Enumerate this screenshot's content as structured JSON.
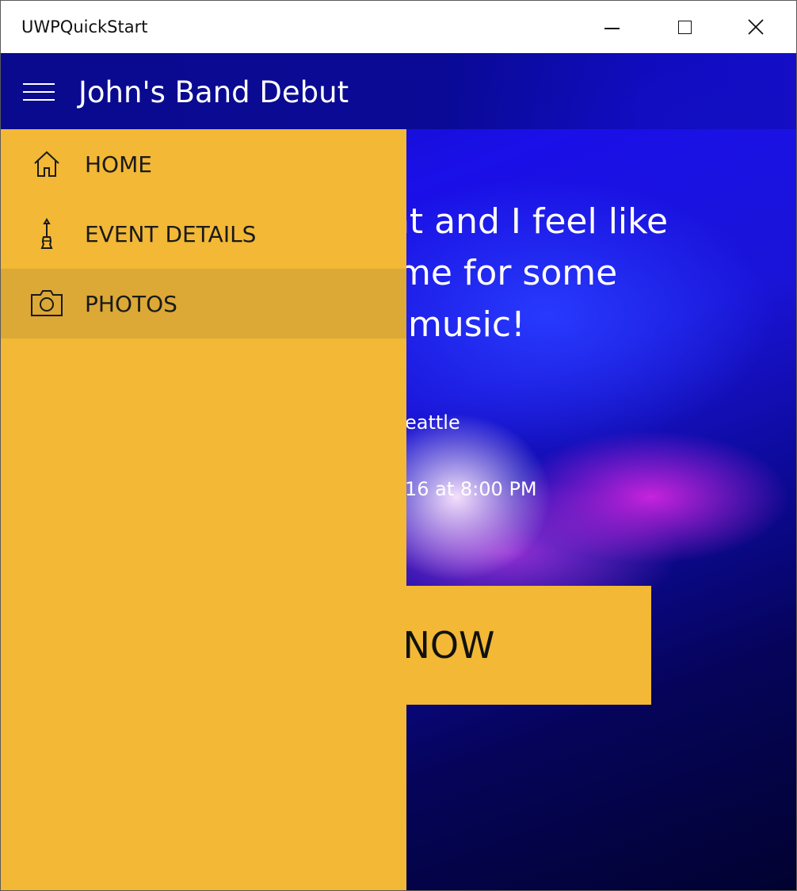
{
  "window": {
    "title": "UWPQuickStart",
    "controls": {
      "minimize": "minimize-icon",
      "maximize": "maximize-icon",
      "close": "close-icon"
    }
  },
  "appbar": {
    "menu_icon": "hamburger-icon",
    "title": "John's Band Debut"
  },
  "nav": {
    "items": [
      {
        "label": "HOME",
        "icon": "home-icon",
        "selected": false
      },
      {
        "label": "EVENT DETAILS",
        "icon": "guitar-icon",
        "selected": false
      },
      {
        "label": "PHOTOS",
        "icon": "camera-icon",
        "selected": true
      }
    ]
  },
  "hero": {
    "line1": "nt and I feel like",
    "line2": " me for some",
    "line3": "music!",
    "location": "eattle",
    "date": "16 at 8:00 PM",
    "button_label": "NOW"
  },
  "colors": {
    "accent": "#f2b836",
    "selected": "#dca836",
    "appbar": "#0a0a8e"
  }
}
